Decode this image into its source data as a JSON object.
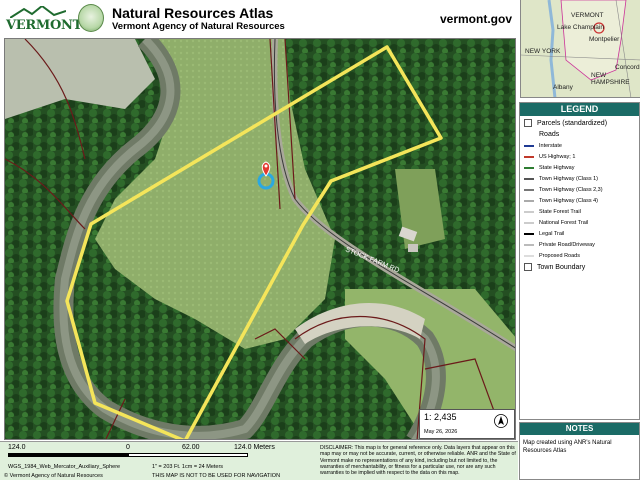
{
  "header": {
    "logo_text": "VERMONT",
    "title": "Natural Resources Atlas",
    "subtitle": "Vermont Agency of Natural Resources",
    "site": "vermont.gov"
  },
  "map": {
    "road_label": "STOCK FARM RD",
    "marker": "map-pin-icon"
  },
  "locator": {
    "labels": [
      "VERMONT",
      "Lake Champlain",
      "Montpelier",
      "NEW YORK",
      "Concord",
      "NEW HAMPSHIRE",
      "Albany"
    ]
  },
  "legend": {
    "title": "LEGEND",
    "items": [
      {
        "label": "Parcels (standardized)",
        "color": "#ffffff"
      },
      {
        "label": "Roads",
        "color": ""
      },
      {
        "label": "Interstate",
        "color": "#1f3a93"
      },
      {
        "label": "US Highway; 1",
        "color": "#c0392b"
      },
      {
        "label": "State Highway",
        "color": "#2e7d32"
      },
      {
        "label": "Town Highway (Class 1)",
        "color": "#555555"
      },
      {
        "label": "Town Highway (Class 2,3)",
        "color": "#777777"
      },
      {
        "label": "Town Highway (Class 4)",
        "color": "#aaaaaa"
      },
      {
        "label": "State Forest Trail",
        "color": "#cccccc"
      },
      {
        "label": "National Forest Trail",
        "color": "#cccccc"
      },
      {
        "label": "Legal Trail",
        "color": "#000000"
      },
      {
        "label": "Private Road/Driveway",
        "color": "#bbbbbb"
      },
      {
        "label": "Proposed Roads",
        "color": "#dddddd"
      },
      {
        "label": "Town Boundary",
        "color": "#ffffff"
      }
    ]
  },
  "notes": {
    "title": "NOTES",
    "text": "Map created using ANR's Natural Resources Atlas"
  },
  "scale": {
    "ratio": "1: 2,435",
    "date": "May 26, 2026"
  },
  "footer": {
    "scale_labels": [
      "124.0",
      "0",
      "62.00",
      "124.0 Meters"
    ],
    "projection": "WGS_1984_Web_Mercator_Auxiliary_Sphere",
    "units": "1\" = 203 Ft. 1cm = 24 Meters",
    "copyright": "© Vermont Agency of Natural Resources",
    "not_nav": "THIS MAP IS NOT TO BE USED FOR NAVIGATION",
    "disclaimer": "DISCLAIMER: This map is for general reference only. Data layers that appear on this map may or may not be accurate, current, or otherwise reliable. ANR and the State of Vermont make no representations of any kind, including but not limited to, the warranties of merchantability, or fitness for a particular use, nor are any such warranties to be implied with respect to the data on this map."
  },
  "colors": {
    "legend_header": "#1b6b66",
    "footer_bg": "#e0f0dc",
    "boundary": "#f4e55a",
    "parcel_lines": "#6b1a1a"
  }
}
